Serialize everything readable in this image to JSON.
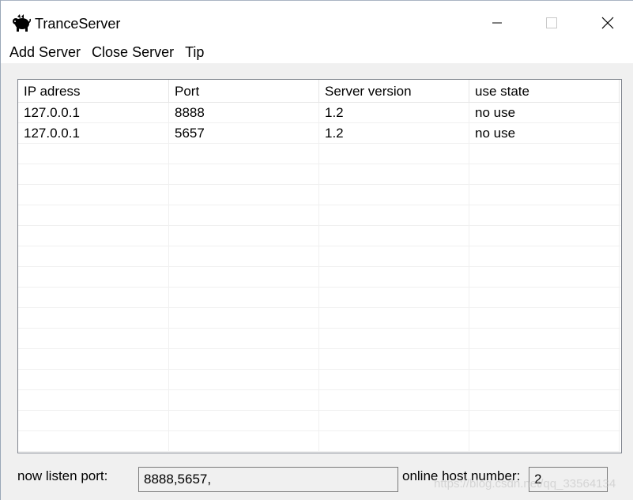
{
  "window": {
    "title": "TranceServer",
    "icon": "pig-icon"
  },
  "menu": {
    "items": [
      "Add Server",
      "Close Server",
      "Tip"
    ]
  },
  "table": {
    "columns": [
      "IP adress",
      "Port",
      "Server version",
      "use state"
    ],
    "rows": [
      [
        "127.0.0.1",
        "8888",
        "1.2",
        "no use"
      ],
      [
        "127.0.0.1",
        "5657",
        "1.2",
        "no use"
      ]
    ]
  },
  "status": {
    "listen_label": "now  listen port:",
    "listen_value": "8888,5657,",
    "online_label": "online host number:",
    "online_value": "2"
  },
  "watermark": "https://blog.csdn.net/qq_33564134"
}
